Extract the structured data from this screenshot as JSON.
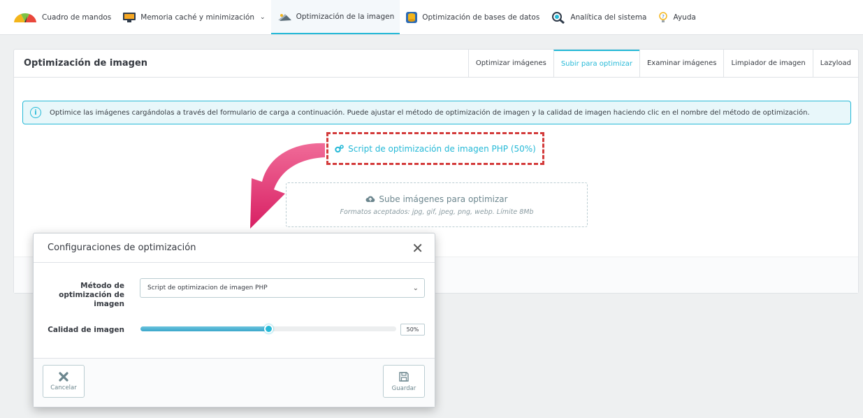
{
  "nav": {
    "items": [
      {
        "label": "Cuadro de mandos",
        "icon": "gauge-icon"
      },
      {
        "label": "Memoria caché y minimización",
        "icon": "monitor-icon",
        "has_dropdown": true
      },
      {
        "label": "Optimización de la imagen",
        "icon": "image-icon",
        "active": true
      },
      {
        "label": "Optimización de bases de datos",
        "icon": "database-icon"
      },
      {
        "label": "Analítica del sistema",
        "icon": "analytics-icon"
      },
      {
        "label": "Ayuda",
        "icon": "help-icon"
      }
    ]
  },
  "panel": {
    "title": "Optimización de imagen",
    "tabs": [
      {
        "label": "Optimizar imágenes"
      },
      {
        "label": "Subir para optimizar",
        "active": true
      },
      {
        "label": "Examinar imágenes"
      },
      {
        "label": "Limpiador de imagen"
      },
      {
        "label": "Lazyload"
      }
    ],
    "info_text": "Optimice las imágenes cargándolas a través del formulario de carga a continuación. Puede ajustar el método de optimización de imagen y la calidad de imagen haciendo clic en el nombre del método de optimización.",
    "script_link": "Script de optimización de imagen PHP (50%)",
    "upload_title": "Sube imágenes para optimizar",
    "upload_subtitle": "Formatos aceptados: jpg, gif, jpeg, png, webp. Límite 8Mb"
  },
  "modal": {
    "title": "Configuraciones de optimización",
    "method_label": "Método de optimización de imagen",
    "method_value": "Script de optimizacion de imagen PHP",
    "quality_label": "Calidad de imagen",
    "quality_value": "50%",
    "quality_fraction": 0.5,
    "cancel_label": "Cancelar",
    "save_label": "Guardar"
  },
  "colors": {
    "accent": "#25b9d7",
    "highlight_border": "#d33b3b",
    "arrow": "#e5467a"
  }
}
